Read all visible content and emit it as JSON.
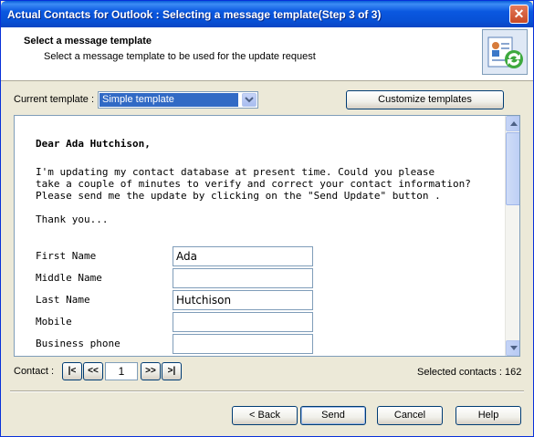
{
  "window": {
    "title": "Actual Contacts for Outlook : Selecting a message template(Step 3 of 3)",
    "close_glyph": "✕"
  },
  "header": {
    "title": "Select a message template",
    "subtitle": "Select a message template to be used for the update request",
    "icon": "contact-card-sync-icon"
  },
  "template": {
    "label": "Current template :",
    "value": "Simple template"
  },
  "customize_label": "Customize templates",
  "preview": {
    "greeting": "Dear Ada Hutchison,",
    "body_line1": "I'm updating my contact database at present time. Could you please",
    "body_line2": "take a couple of minutes to verify and correct your contact information?",
    "body_line3": "Please send me the update by clicking on the \"Send Update\" button .",
    "thanks": "Thank you...",
    "fields": [
      {
        "label": "First Name",
        "value": "Ada"
      },
      {
        "label": "Middle Name",
        "value": ""
      },
      {
        "label": "Last Name",
        "value": "Hutchison"
      },
      {
        "label": "Mobile",
        "value": ""
      },
      {
        "label": "Business phone",
        "value": ""
      }
    ]
  },
  "contact_nav": {
    "label": "Contact :",
    "first": "|<",
    "prev": "<<",
    "page": "1",
    "next": ">>",
    "last": ">|",
    "selected": "Selected contacts : 162"
  },
  "buttons": {
    "back": "< Back",
    "send": "Send",
    "cancel": "Cancel",
    "help": "Help"
  },
  "colors": {
    "titlebar": "#0a58e0",
    "selection": "#316ac5",
    "face": "#ece9d8"
  }
}
